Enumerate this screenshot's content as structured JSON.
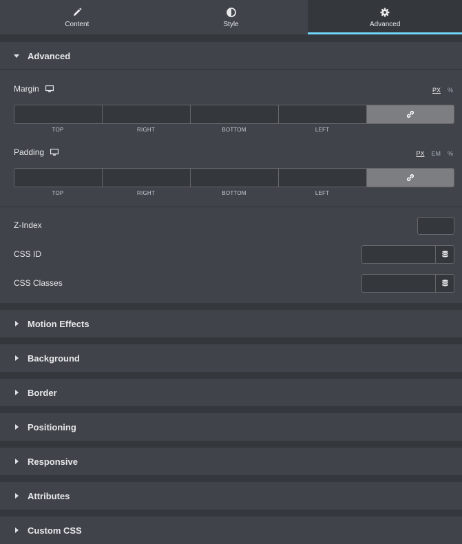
{
  "tabs": [
    {
      "label": "Content",
      "icon": "pencil-icon"
    },
    {
      "label": "Style",
      "icon": "half-circle-icon"
    },
    {
      "label": "Advanced",
      "icon": "gear-icon",
      "active": true
    }
  ],
  "advanced_section": {
    "title": "Advanced",
    "margin": {
      "label": "Margin",
      "units": [
        "PX",
        "%"
      ],
      "active_unit": "PX",
      "values": {
        "top": "",
        "right": "",
        "bottom": "",
        "left": ""
      },
      "sides": [
        "TOP",
        "RIGHT",
        "BOTTOM",
        "LEFT"
      ]
    },
    "padding": {
      "label": "Padding",
      "units": [
        "PX",
        "EM",
        "%"
      ],
      "active_unit": "PX",
      "values": {
        "top": "",
        "right": "",
        "bottom": "",
        "left": ""
      },
      "sides": [
        "TOP",
        "RIGHT",
        "BOTTOM",
        "LEFT"
      ]
    },
    "z_index": {
      "label": "Z-Index",
      "value": ""
    },
    "css_id": {
      "label": "CSS ID",
      "value": ""
    },
    "css_classes": {
      "label": "CSS Classes",
      "value": ""
    }
  },
  "collapsed_sections": [
    "Motion Effects",
    "Background",
    "Border",
    "Positioning",
    "Responsive",
    "Attributes",
    "Custom CSS"
  ],
  "colors": {
    "panel_bg": "#404349",
    "gap_bg": "#34373c",
    "accent": "#71d7f7",
    "link_button_bg": "#7d7e82"
  }
}
